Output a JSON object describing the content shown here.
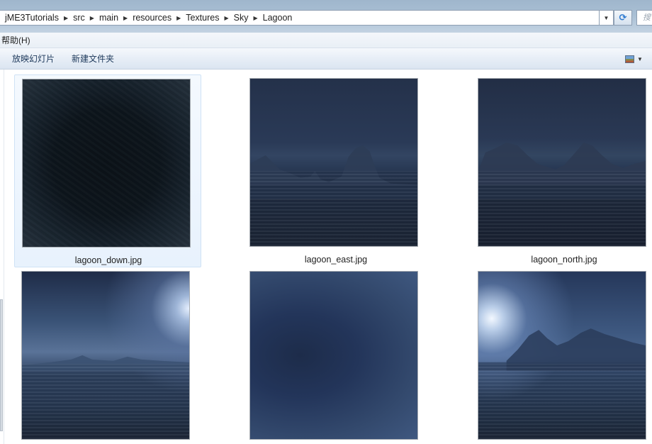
{
  "window": {
    "breadcrumb": [
      "jME3Tutorials",
      "src",
      "main",
      "resources",
      "Textures",
      "Sky",
      "Lagoon"
    ],
    "search_placeholder": "搜"
  },
  "menubar": {
    "items": [
      "帮助(H)"
    ]
  },
  "commandbar": {
    "items": [
      "放映幻灯片",
      "新建文件夹"
    ],
    "view_icon": "view-options-icon"
  },
  "files": [
    {
      "name": "lagoon_down.jpg",
      "selected": true
    },
    {
      "name": "lagoon_east.jpg",
      "selected": false
    },
    {
      "name": "lagoon_north.jpg",
      "selected": false
    },
    {
      "name": "",
      "selected": false
    },
    {
      "name": "",
      "selected": false
    },
    {
      "name": "",
      "selected": false
    }
  ],
  "colors": {
    "selection_fill": "#e8f2fd",
    "selection_border": "#cfe2f5",
    "address_gradient": "#a9bfd4",
    "refresh_arrow": "#2f7bd0"
  }
}
